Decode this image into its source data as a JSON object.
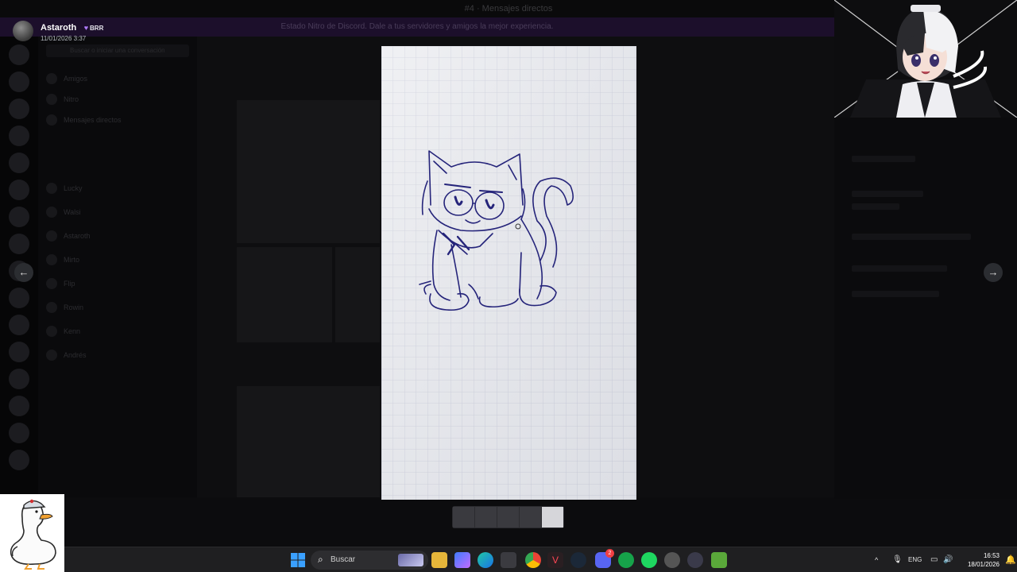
{
  "app": {
    "title": "#4 · Mensajes directos",
    "banner": "Estado Nitro de Discord. Dale a tus servidores y amigos la mejor experiencia.",
    "search_placeholder": "Buscar o iniciar una conversación"
  },
  "dm_list": [
    "Amigos",
    "Nitro",
    "Mensajes directos",
    "Lucky",
    "Walsi",
    "Astaroth",
    "Mirto",
    "Flip",
    "Rowin",
    "Kenn",
    "Andrés"
  ],
  "header": {
    "user_name": "Astaroth",
    "tag": "BRR",
    "date": "11/01/2026 3:37"
  },
  "viewer": {
    "prev_label": "←",
    "next_label": "→",
    "thumbnails": 5,
    "active_thumbnail": 5
  },
  "taskbar": {
    "search_label": "Buscar",
    "language": "ENG",
    "time": "16:53",
    "date": "18/01/2026",
    "discord_badge": "2"
  },
  "colors": {
    "accent": "#5865f2",
    "drawing_ink": "#25247a",
    "paper": "#ebecf0"
  }
}
